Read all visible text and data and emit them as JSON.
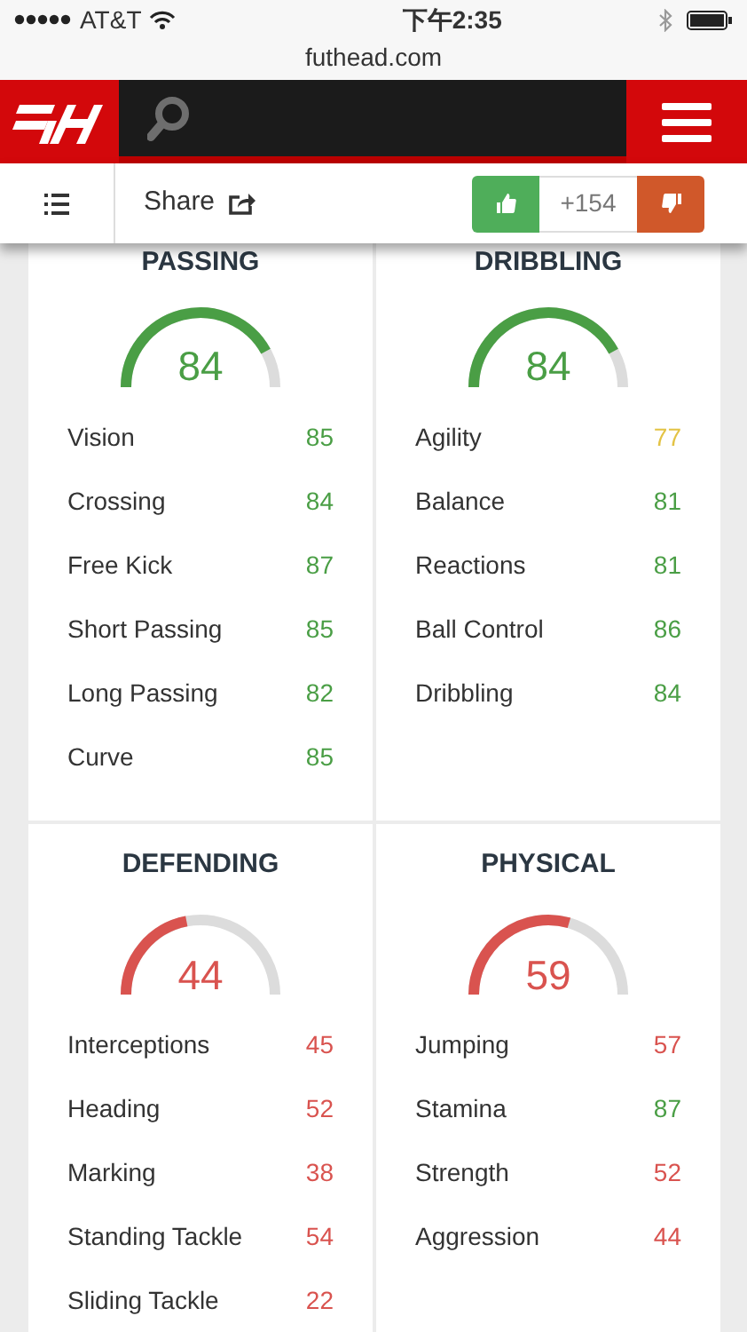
{
  "status_bar": {
    "carrier": "AT&T",
    "time": "下午2:35",
    "url": "futhead.com"
  },
  "toolbar": {
    "share": "Share",
    "votes": "+154"
  },
  "sections": [
    {
      "title": "PASSING",
      "rating": "84",
      "color": "#4a9e45",
      "stats": [
        {
          "name": "Vision",
          "value": "85",
          "color": "#4a9e45"
        },
        {
          "name": "Crossing",
          "value": "84",
          "color": "#4a9e45"
        },
        {
          "name": "Free Kick",
          "value": "87",
          "color": "#4a9e45"
        },
        {
          "name": "Short Passing",
          "value": "85",
          "color": "#4a9e45"
        },
        {
          "name": "Long Passing",
          "value": "82",
          "color": "#4a9e45"
        },
        {
          "name": "Curve",
          "value": "85",
          "color": "#4a9e45"
        }
      ]
    },
    {
      "title": "DRIBBLING",
      "rating": "84",
      "color": "#4a9e45",
      "stats": [
        {
          "name": "Agility",
          "value": "77",
          "color": "#e3c345"
        },
        {
          "name": "Balance",
          "value": "81",
          "color": "#4a9e45"
        },
        {
          "name": "Reactions",
          "value": "81",
          "color": "#4a9e45"
        },
        {
          "name": "Ball Control",
          "value": "86",
          "color": "#4a9e45"
        },
        {
          "name": "Dribbling",
          "value": "84",
          "color": "#4a9e45"
        }
      ]
    },
    {
      "title": "DEFENDING",
      "rating": "44",
      "color": "#d9534f",
      "stats": [
        {
          "name": "Interceptions",
          "value": "45",
          "color": "#d9534f"
        },
        {
          "name": "Heading",
          "value": "52",
          "color": "#d9534f"
        },
        {
          "name": "Marking",
          "value": "38",
          "color": "#d9534f"
        },
        {
          "name": "Standing Tackle",
          "value": "54",
          "color": "#d9534f"
        },
        {
          "name": "Sliding Tackle",
          "value": "22",
          "color": "#d9534f"
        }
      ]
    },
    {
      "title": "PHYSICAL",
      "rating": "59",
      "color": "#d9534f",
      "stats": [
        {
          "name": "Jumping",
          "value": "57",
          "color": "#d9534f"
        },
        {
          "name": "Stamina",
          "value": "87",
          "color": "#4a9e45"
        },
        {
          "name": "Strength",
          "value": "52",
          "color": "#d9534f"
        },
        {
          "name": "Aggression",
          "value": "44",
          "color": "#d9534f"
        }
      ]
    }
  ]
}
